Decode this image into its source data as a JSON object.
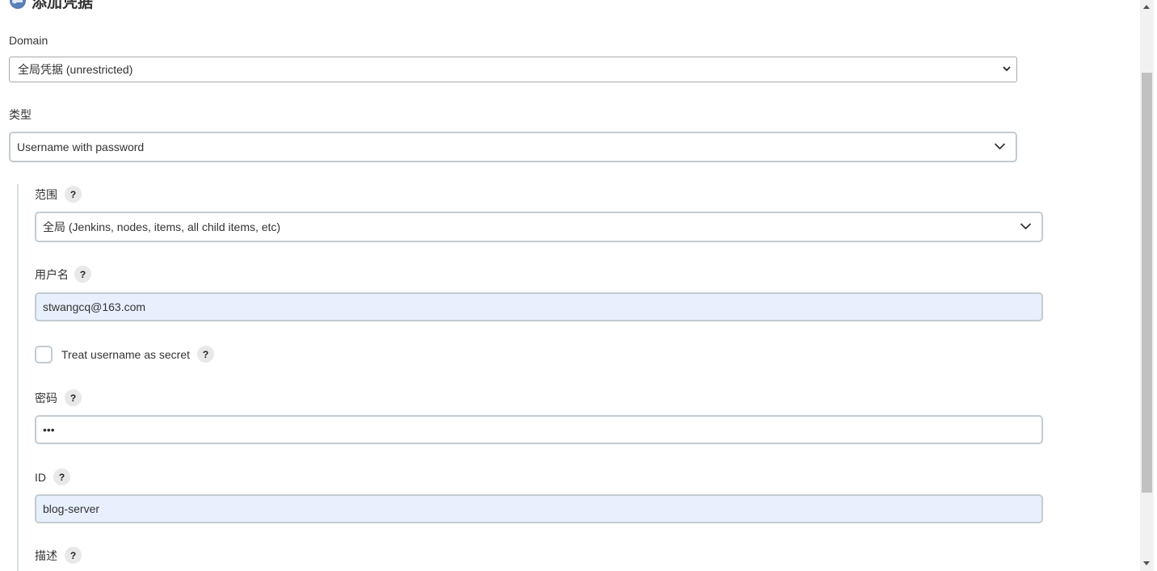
{
  "page": {
    "title": "添加凭据",
    "title_icon": "credentials-key-icon"
  },
  "domain": {
    "label": "Domain",
    "value": "全局凭据 (unrestricted)"
  },
  "kind": {
    "label": "类型",
    "value": "Username with password"
  },
  "scope": {
    "label": "范围",
    "value": "全局 (Jenkins, nodes, items, all child items, etc)"
  },
  "username": {
    "label": "用户名",
    "value": "stwangcq@163.com"
  },
  "username_secret": {
    "label": "Treat username as secret",
    "checked": false
  },
  "password": {
    "label": "密码",
    "value": "•••"
  },
  "id": {
    "label": "ID",
    "value": "blog-server"
  },
  "description": {
    "label": "描述"
  },
  "help": {
    "glyph": "?"
  },
  "colors": {
    "autofill_bg": "#e8f0fe",
    "border": "#c3cbd1"
  }
}
